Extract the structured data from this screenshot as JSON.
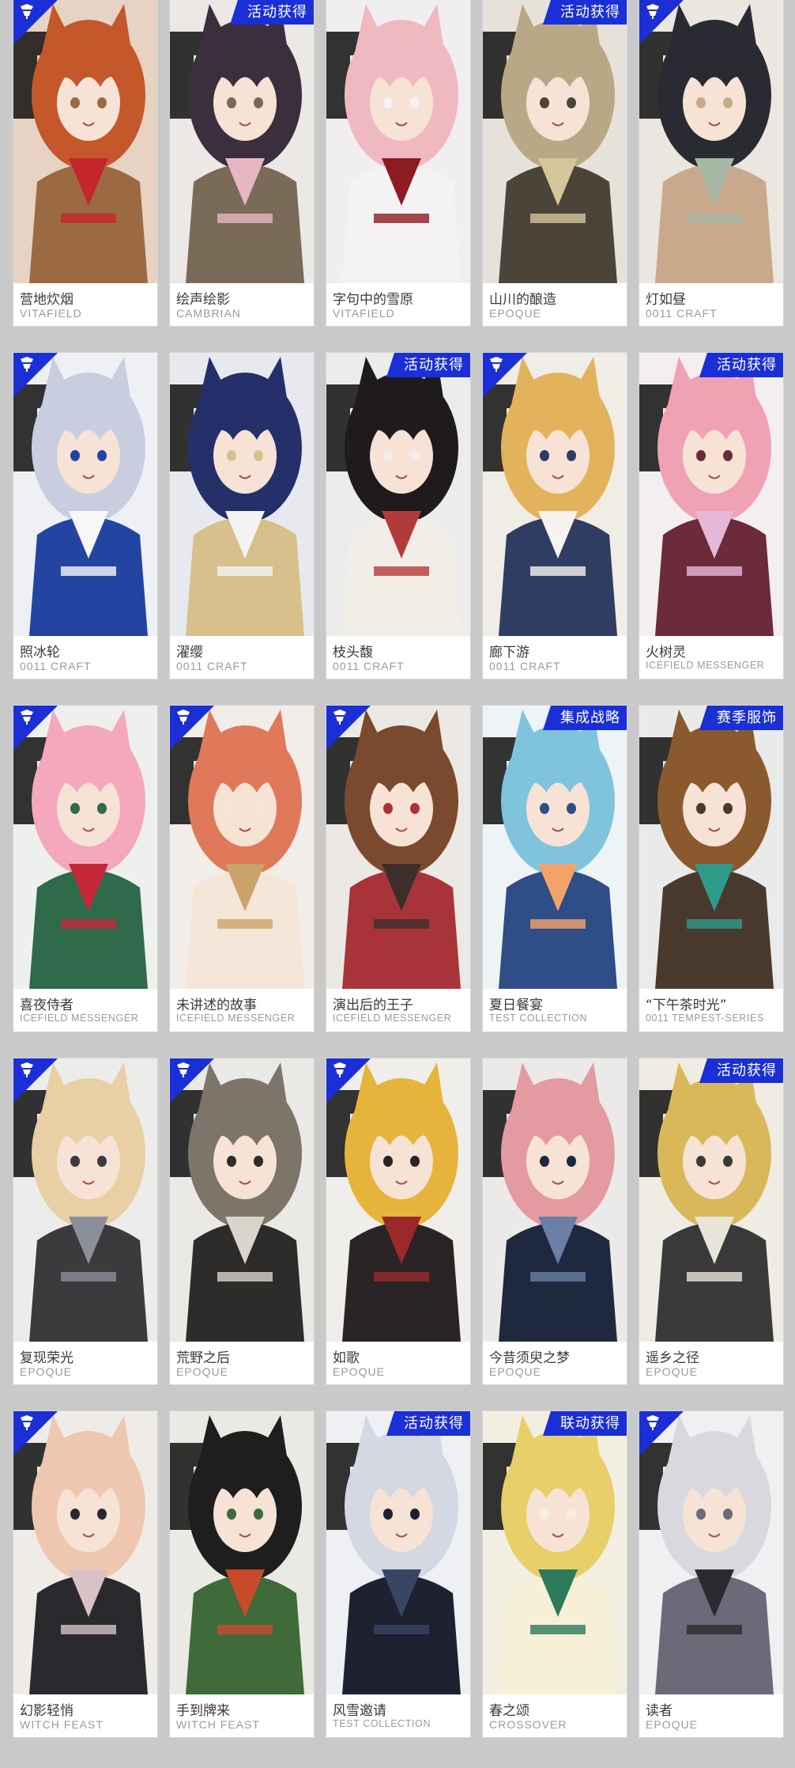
{
  "colors": {
    "background": "#c9c9c9",
    "accent": "#1b2fd6",
    "name_text": "#3a3a3a",
    "series_text": "#9a9a9a"
  },
  "cards": [
    {
      "name": "营地炊烟",
      "series": "VITAFIELD",
      "corner_icon": "brand-corner-icon",
      "tag": "",
      "palette": [
        "#e7d3c4",
        "#c4582b",
        "#9b6a43",
        "#c5252c"
      ]
    },
    {
      "name": "绘声绘影",
      "series": "CAMBRIAN",
      "corner_icon": "",
      "tag": "活动获得",
      "palette": [
        "#ebe8e6",
        "#3b2f3e",
        "#7a6a58",
        "#e6b7c2"
      ]
    },
    {
      "name": "字句中的雪原",
      "series": "VITAFIELD",
      "corner_icon": "",
      "tag": "",
      "palette": [
        "#f1eef0",
        "#efb9c0",
        "#f5f2f4",
        "#8f1b22"
      ]
    },
    {
      "name": "山川的酿造",
      "series": "EPOQUE",
      "corner_icon": "",
      "tag": "活动获得",
      "palette": [
        "#e6e2da",
        "#b9a886",
        "#4b4438",
        "#d5c59a"
      ]
    },
    {
      "name": "灯如昼",
      "series": "0011 CRAFT",
      "corner_icon": "brand-corner-icon",
      "tag": "",
      "palette": [
        "#ebe6e0",
        "#2a2a32",
        "#c9a98b",
        "#a6b7a4"
      ]
    },
    {
      "name": "照冰轮",
      "series": "0011 CRAFT",
      "corner_icon": "brand-corner-icon",
      "tag": "",
      "palette": [
        "#eef0f4",
        "#c9cde0",
        "#2345a1",
        "#f7f7f7"
      ]
    },
    {
      "name": "濯缨",
      "series": "0011 CRAFT",
      "corner_icon": "",
      "tag": "",
      "palette": [
        "#e8e9ef",
        "#25306a",
        "#d7c08c",
        "#f3f3f3"
      ]
    },
    {
      "name": "枝头馥",
      "series": "0011 CRAFT",
      "corner_icon": "",
      "tag": "活动获得",
      "palette": [
        "#ececec",
        "#1f1a1c",
        "#f3ede8",
        "#b33a3a"
      ]
    },
    {
      "name": "廊下游",
      "series": "0011 CRAFT",
      "corner_icon": "brand-corner-icon",
      "tag": "",
      "palette": [
        "#f0ede6",
        "#e2b35a",
        "#2f3d63",
        "#f7f4ef"
      ]
    },
    {
      "name": "火树灵",
      "series": "ICEFIELD MESSENGER",
      "corner_icon": "",
      "tag": "活动获得",
      "palette": [
        "#f3eef0",
        "#f0a2b5",
        "#6b2b3b",
        "#e6b8d7"
      ]
    },
    {
      "name": "喜夜侍者",
      "series": "ICEFIELD MESSENGER",
      "corner_icon": "brand-corner-icon",
      "tag": "",
      "palette": [
        "#eef0ee",
        "#f4a7bd",
        "#2f6a4a",
        "#c6283a"
      ]
    },
    {
      "name": "未讲述的故事",
      "series": "ICEFIELD MESSENGER",
      "corner_icon": "brand-corner-icon",
      "tag": "",
      "palette": [
        "#f2ede8",
        "#e0785a",
        "#f4e6d8",
        "#c9a36a"
      ]
    },
    {
      "name": "演出后的王子",
      "series": "ICEFIELD MESSENGER",
      "corner_icon": "brand-corner-icon",
      "tag": "",
      "palette": [
        "#ece8e4",
        "#7b4a2e",
        "#a8343a",
        "#3c2e2a"
      ]
    },
    {
      "name": "夏日餐宴",
      "series": "TEST COLLECTION",
      "corner_icon": "",
      "tag": "集成战略",
      "palette": [
        "#eef3f6",
        "#7fc4dc",
        "#2f4d86",
        "#f3a36a"
      ]
    },
    {
      "name": "“下午茶时光”",
      "series": "0011 TEMPEST-SERIES",
      "corner_icon": "",
      "tag": "赛季服饰",
      "palette": [
        "#e9eaea",
        "#8a5a2e",
        "#4a3a2e",
        "#2e9a8a"
      ]
    },
    {
      "name": "复现荣光",
      "series": "EPOQUE",
      "corner_icon": "brand-corner-icon",
      "tag": "",
      "palette": [
        "#ececea",
        "#e8cfa4",
        "#3c3a3c",
        "#8a8f9a"
      ]
    },
    {
      "name": "荒野之后",
      "series": "EPOQUE",
      "corner_icon": "brand-corner-icon",
      "tag": "",
      "palette": [
        "#eae9e6",
        "#7d756a",
        "#2e2c2a",
        "#d9d5cc"
      ]
    },
    {
      "name": "如歌",
      "series": "EPOQUE",
      "corner_icon": "brand-corner-icon",
      "tag": "",
      "palette": [
        "#f0eeea",
        "#e6b43a",
        "#2a2426",
        "#9a2a2a"
      ]
    },
    {
      "name": "今昔须臾之梦",
      "series": "EPOQUE",
      "corner_icon": "",
      "tag": "",
      "palette": [
        "#eceae8",
        "#e39aa0",
        "#1e2940",
        "#6a7fa3"
      ]
    },
    {
      "name": "遥乡之径",
      "series": "EPOQUE",
      "corner_icon": "",
      "tag": "活动获得",
      "palette": [
        "#efece4",
        "#d9b85a",
        "#3a3a3a",
        "#e9e4d8"
      ]
    },
    {
      "name": "幻影轻悄",
      "series": "WITCH FEAST",
      "corner_icon": "brand-corner-icon",
      "tag": "",
      "palette": [
        "#efece8",
        "#efc7b0",
        "#2a2a2e",
        "#d8c2c6"
      ]
    },
    {
      "name": "手到牌来",
      "series": "WITCH FEAST",
      "corner_icon": "",
      "tag": "",
      "palette": [
        "#eae9e4",
        "#1e1e1e",
        "#3f6b3a",
        "#c94a2a"
      ]
    },
    {
      "name": "风雪邀请",
      "series": "TEST COLLECTION",
      "corner_icon": "",
      "tag": "活动获得",
      "palette": [
        "#eef0f3",
        "#d3d8e2",
        "#1d2130",
        "#3a4566"
      ]
    },
    {
      "name": "春之颂",
      "series": "CROSSOVER",
      "corner_icon": "",
      "tag": "联动获得",
      "palette": [
        "#f2efe2",
        "#e8cf6a",
        "#f6f1d6",
        "#2e7a5a"
      ]
    },
    {
      "name": "读者",
      "series": "EPOQUE",
      "corner_icon": "brand-corner-icon",
      "tag": "",
      "palette": [
        "#f0f0f2",
        "#d8d8de",
        "#6a6a78",
        "#2a2a30"
      ]
    }
  ]
}
